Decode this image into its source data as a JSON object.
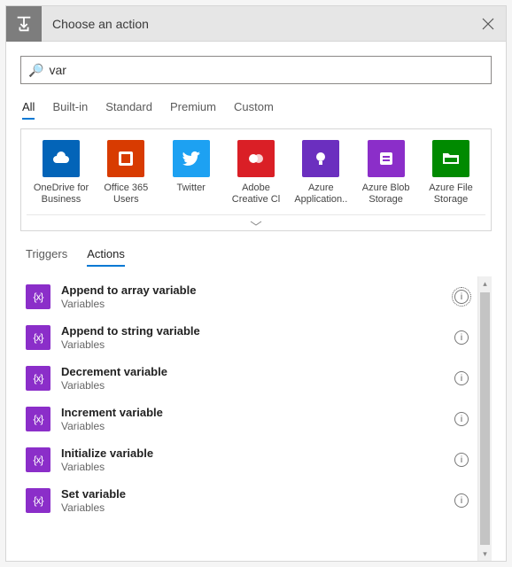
{
  "header": {
    "title": "Choose an action"
  },
  "search": {
    "value": "var"
  },
  "tabs": [
    "All",
    "Built-in",
    "Standard",
    "Premium",
    "Custom"
  ],
  "active_tab": 0,
  "connectors": [
    {
      "label": "OneDrive for Business",
      "color": "#0364b8",
      "icon": "cloud"
    },
    {
      "label": "Office 365 Users",
      "color": "#d83b01",
      "icon": "office"
    },
    {
      "label": "Twitter",
      "color": "#1da1f2",
      "icon": "twitter"
    },
    {
      "label": "Adobe Creative Cl",
      "color": "#da1f26",
      "icon": "adobe"
    },
    {
      "label": "Azure Application..",
      "color": "#6b2fbf",
      "icon": "bulb"
    },
    {
      "label": "Azure Blob Storage",
      "color": "#8b2ec9",
      "icon": "blob"
    },
    {
      "label": "Azure File Storage",
      "color": "#008a00",
      "icon": "folder"
    }
  ],
  "subtabs": [
    "Triggers",
    "Actions"
  ],
  "active_subtab": 1,
  "actions": [
    {
      "title": "Append to array variable",
      "sub": "Variables",
      "info_focused": true
    },
    {
      "title": "Append to string variable",
      "sub": "Variables",
      "info_focused": false
    },
    {
      "title": "Decrement variable",
      "sub": "Variables",
      "info_focused": false
    },
    {
      "title": "Increment variable",
      "sub": "Variables",
      "info_focused": false
    },
    {
      "title": "Initialize variable",
      "sub": "Variables",
      "info_focused": false
    },
    {
      "title": "Set variable",
      "sub": "Variables",
      "info_focused": false
    }
  ]
}
